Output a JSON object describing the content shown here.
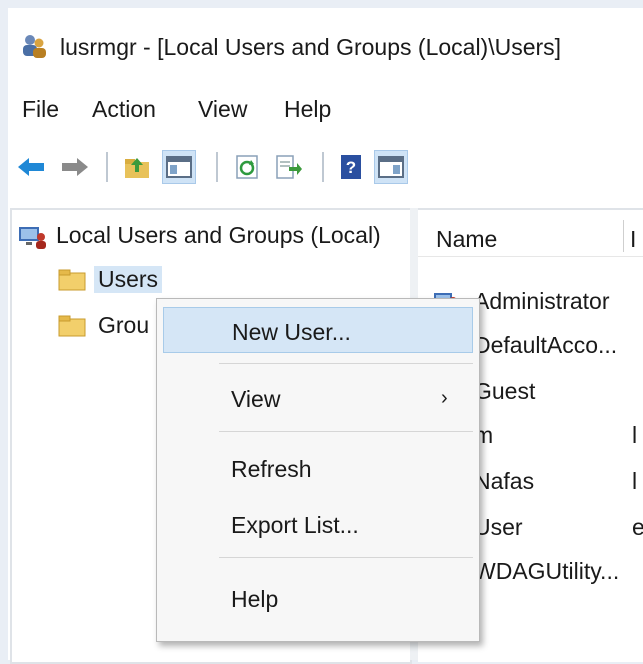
{
  "window": {
    "title": "lusrmgr - [Local Users and Groups (Local)\\Users]",
    "accent_color": "#cfe3f6"
  },
  "menubar": {
    "items": [
      {
        "label": "File"
      },
      {
        "label": "Action"
      },
      {
        "label": "View"
      },
      {
        "label": "Help"
      }
    ]
  },
  "toolbar": {
    "buttons": [
      {
        "icon": "back-arrow-icon"
      },
      {
        "icon": "forward-arrow-icon"
      },
      {
        "icon": "up-folder-icon"
      },
      {
        "icon": "show-hide-console-tree-icon",
        "pressed": true
      },
      {
        "icon": "refresh-icon"
      },
      {
        "icon": "export-list-icon"
      },
      {
        "icon": "help-icon"
      },
      {
        "icon": "show-hide-action-pane-icon",
        "pressed": true
      }
    ]
  },
  "tree": {
    "root_label": "Local Users and Groups (Local)",
    "children": [
      {
        "label": "Users",
        "selected": true
      },
      {
        "label": "Grou"
      }
    ]
  },
  "list": {
    "columns": [
      {
        "label": "Name"
      },
      {
        "label": "I"
      }
    ],
    "rows": [
      {
        "name": "Administrator",
        "extra": ""
      },
      {
        "name": "DefaultAcco...",
        "extra": ""
      },
      {
        "name": "Guest",
        "extra": ""
      },
      {
        "name": "m",
        "extra": "l"
      },
      {
        "name": "Nafas",
        "extra": "l"
      },
      {
        "name": "User",
        "extra": "e"
      },
      {
        "name": "WDAGUtility...",
        "extra": ""
      }
    ]
  },
  "context_menu": {
    "items": [
      {
        "label": "New User...",
        "highlighted": true
      },
      {
        "label": "View",
        "has_submenu": true,
        "submenu_glyph": "›"
      },
      {
        "label": "Refresh"
      },
      {
        "label": "Export List..."
      },
      {
        "label": "Help"
      }
    ]
  }
}
